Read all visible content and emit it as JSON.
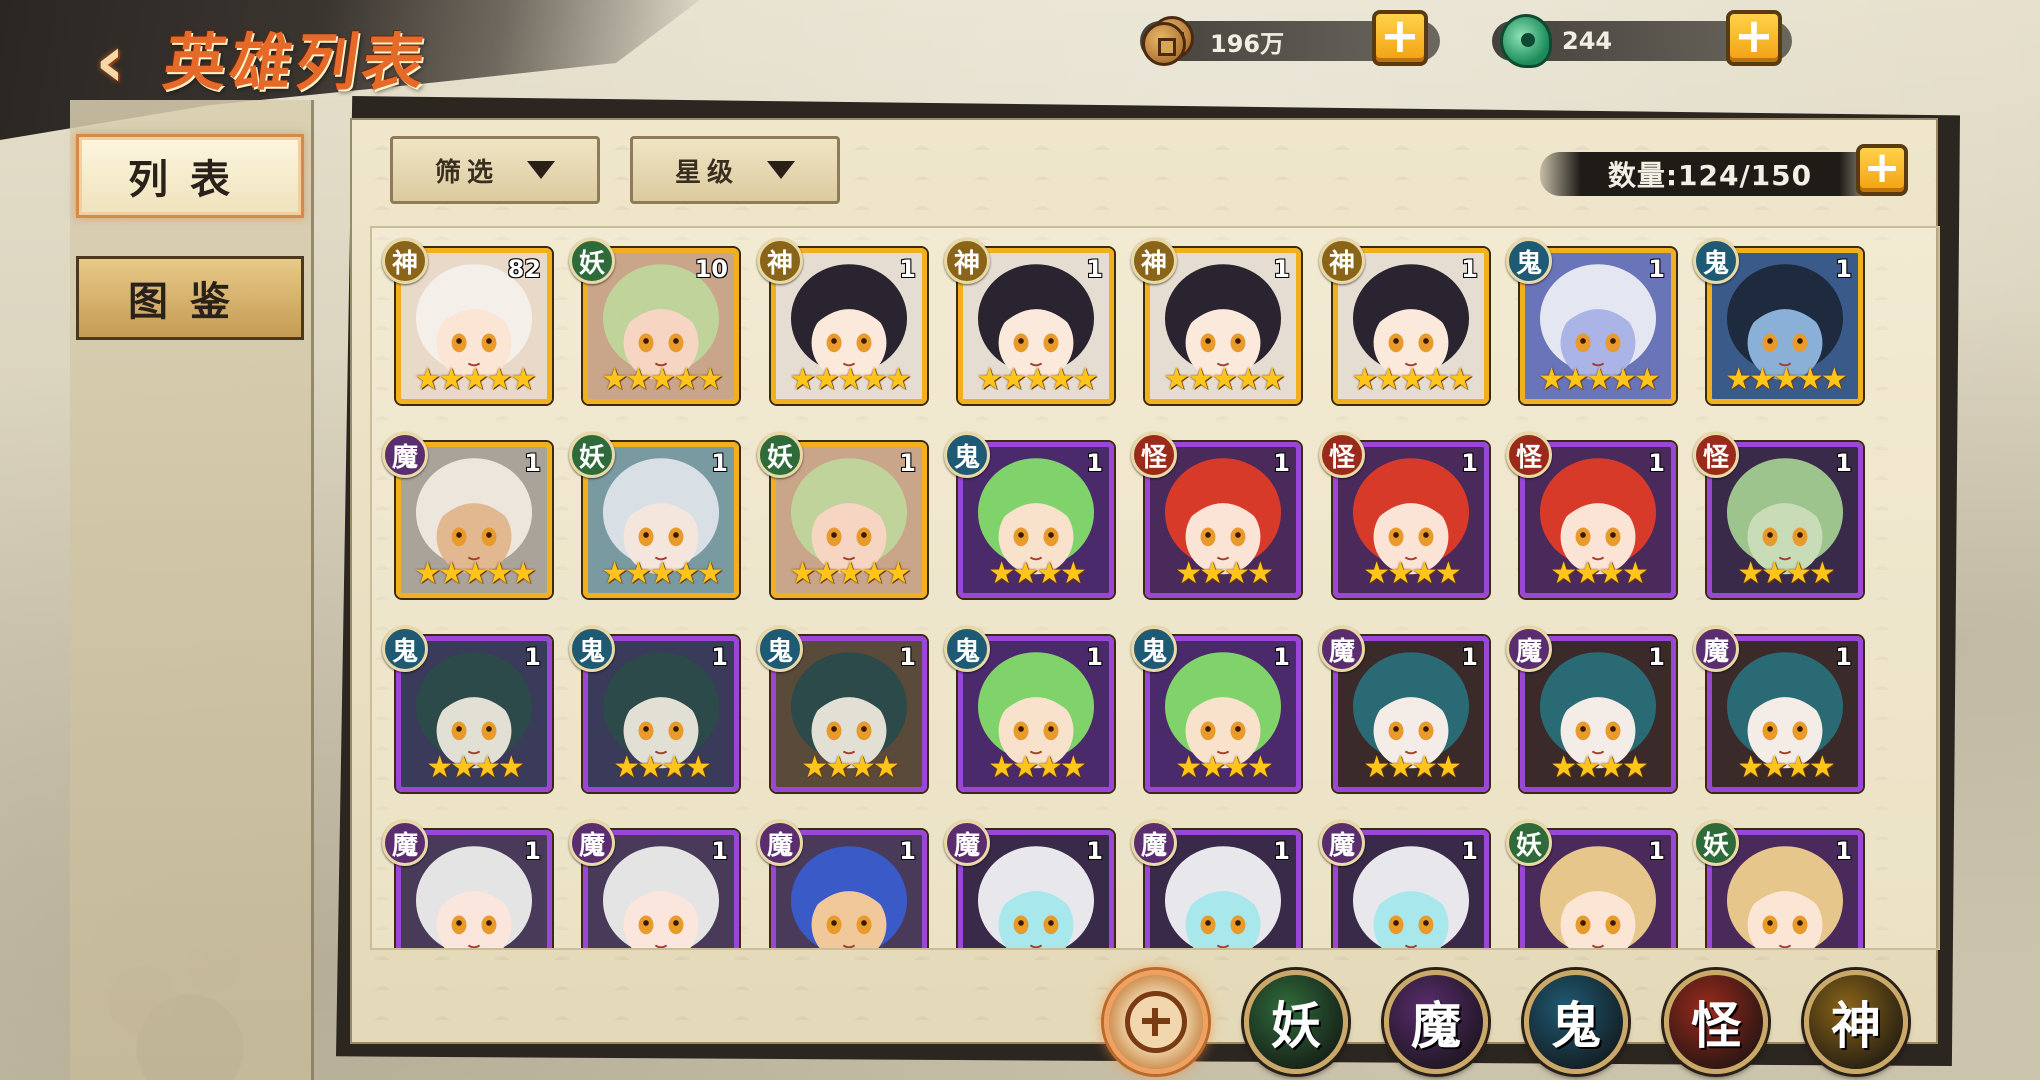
{
  "header": {
    "title": "英雄列表",
    "back_label": "‹"
  },
  "currency": {
    "coins": "196万",
    "jade": "244",
    "plus_label": "+"
  },
  "sidebar": {
    "tabs": [
      {
        "label": "列表",
        "active": true
      },
      {
        "label": "图鉴",
        "active": false
      }
    ]
  },
  "filters": {
    "filter_label": "筛选",
    "star_label": "星级"
  },
  "count": {
    "text": "数量:124/150",
    "plus_label": "+"
  },
  "factions": {
    "all": {
      "icon": "all-factions-emblem-icon"
    },
    "items": [
      {
        "label": "妖",
        "color": "#2f6b3a"
      },
      {
        "label": "魔",
        "color": "#5a2d6e"
      },
      {
        "label": "鬼",
        "color": "#1f5a74"
      },
      {
        "label": "怪",
        "color": "#9a2a1c"
      },
      {
        "label": "神",
        "color": "#8a6418"
      }
    ]
  },
  "colors": {
    "gold_frame": "#f2b01e",
    "purple_frame": "#9a46d6",
    "badge_神": "#8a6418",
    "badge_妖": "#2f6b3a",
    "badge_魔": "#5a2d6e",
    "badge_鬼": "#1f5a74",
    "badge_怪": "#9a2a1c"
  },
  "heroes": [
    {
      "type": "神",
      "level": "82",
      "stars": "★★★★★",
      "frame": "gold",
      "hair": "#f4efe8",
      "skin": "#fbe6d6",
      "bg": "#e9d9c8"
    },
    {
      "type": "妖",
      "level": "10",
      "stars": "★★★★★",
      "frame": "gold",
      "hair": "#bfd39a",
      "skin": "#f6d6c2",
      "bg": "#c9a58a"
    },
    {
      "type": "神",
      "level": "1",
      "stars": "★★★★★",
      "frame": "gold",
      "hair": "#2a2430",
      "skin": "#fbe9dc",
      "bg": "#e6ddd2"
    },
    {
      "type": "神",
      "level": "1",
      "stars": "★★★★★",
      "frame": "gold",
      "hair": "#2a2430",
      "skin": "#fbe9dc",
      "bg": "#e6ddd2"
    },
    {
      "type": "神",
      "level": "1",
      "stars": "★★★★★",
      "frame": "gold",
      "hair": "#2a2430",
      "skin": "#fbe9dc",
      "bg": "#e6ddd2"
    },
    {
      "type": "神",
      "level": "1",
      "stars": "★★★★★",
      "frame": "gold",
      "hair": "#2a2430",
      "skin": "#fbe9dc",
      "bg": "#e6ddd2"
    },
    {
      "type": "鬼",
      "level": "1",
      "stars": "★★★★★",
      "frame": "gold",
      "hair": "#e4e6f2",
      "skin": "#aab4e6",
      "bg": "#6a74b8"
    },
    {
      "type": "鬼",
      "level": "1",
      "stars": "★★★★★",
      "frame": "gold",
      "hair": "#1e2a3e",
      "skin": "#8ab0d8",
      "bg": "#3a5a8a"
    },
    {
      "type": "魔",
      "level": "1",
      "stars": "★★★★★",
      "frame": "gold",
      "hair": "#ece6dc",
      "skin": "#e2b890",
      "bg": "#a9a39a"
    },
    {
      "type": "妖",
      "level": "1",
      "stars": "★★★★★",
      "frame": "gold",
      "hair": "#d8e0e6",
      "skin": "#f4e6dc",
      "bg": "#7a9aa2"
    },
    {
      "type": "妖",
      "level": "1",
      "stars": "★★★★★",
      "frame": "gold",
      "hair": "#bfd39a",
      "skin": "#f6d6c2",
      "bg": "#c9a58a"
    },
    {
      "type": "鬼",
      "level": "1",
      "stars": "★★★★",
      "frame": "purple",
      "hair": "#7fd36a",
      "skin": "#f8e2cc",
      "bg": "#4a2a6a"
    },
    {
      "type": "怪",
      "level": "1",
      "stars": "★★★★",
      "frame": "purple",
      "hair": "#d83a2a",
      "skin": "#fbe4d6",
      "bg": "#4a2a5a"
    },
    {
      "type": "怪",
      "level": "1",
      "stars": "★★★★",
      "frame": "purple",
      "hair": "#d83a2a",
      "skin": "#fbe4d6",
      "bg": "#4a2a5a"
    },
    {
      "type": "怪",
      "level": "1",
      "stars": "★★★★",
      "frame": "purple",
      "hair": "#d83a2a",
      "skin": "#fbe4d6",
      "bg": "#4a2a5a"
    },
    {
      "type": "怪",
      "level": "1",
      "stars": "★★★★",
      "frame": "purple",
      "hair": "#9ec48e",
      "skin": "#c8dcb8",
      "bg": "#3a2a4a"
    },
    {
      "type": "鬼",
      "level": "1",
      "stars": "★★★★",
      "frame": "purple",
      "hair": "#2c4a4a",
      "skin": "#e2e0d4",
      "bg": "#3a3a5a"
    },
    {
      "type": "鬼",
      "level": "1",
      "stars": "★★★★",
      "frame": "purple",
      "hair": "#2c4a4a",
      "skin": "#e2e0d4",
      "bg": "#3a3a5a"
    },
    {
      "type": "鬼",
      "level": "1",
      "stars": "★★★★",
      "frame": "purple",
      "hair": "#2c4a4a",
      "skin": "#e2e0d4",
      "bg": "#5a4a3a"
    },
    {
      "type": "鬼",
      "level": "1",
      "stars": "★★★★",
      "frame": "purple",
      "hair": "#7fd36a",
      "skin": "#f8e2cc",
      "bg": "#4a2a6a"
    },
    {
      "type": "鬼",
      "level": "1",
      "stars": "★★★★",
      "frame": "purple",
      "hair": "#7fd36a",
      "skin": "#f8e2cc",
      "bg": "#4a2a6a"
    },
    {
      "type": "魔",
      "level": "1",
      "stars": "★★★★",
      "frame": "purple",
      "hair": "#2a6a74",
      "skin": "#f4ece6",
      "bg": "#3a2a2a"
    },
    {
      "type": "魔",
      "level": "1",
      "stars": "★★★★",
      "frame": "purple",
      "hair": "#2a6a74",
      "skin": "#f4ece6",
      "bg": "#3a2a2a"
    },
    {
      "type": "魔",
      "level": "1",
      "stars": "★★★★",
      "frame": "purple",
      "hair": "#2a6a74",
      "skin": "#f4ece6",
      "bg": "#3a2a2a"
    },
    {
      "type": "魔",
      "level": "1",
      "stars": "",
      "frame": "purple",
      "hair": "#e4e4e4",
      "skin": "#fae6dc",
      "bg": "#4a3a5a"
    },
    {
      "type": "魔",
      "level": "1",
      "stars": "",
      "frame": "purple",
      "hair": "#e4e4e4",
      "skin": "#fae6dc",
      "bg": "#4a3a5a"
    },
    {
      "type": "魔",
      "level": "1",
      "stars": "",
      "frame": "purple",
      "hair": "#3a5ac8",
      "skin": "#f0c89a",
      "bg": "#4a3a5a"
    },
    {
      "type": "魔",
      "level": "1",
      "stars": "",
      "frame": "purple",
      "hair": "#e8e8ec",
      "skin": "#a8e8ec",
      "bg": "#3a2a4a"
    },
    {
      "type": "魔",
      "level": "1",
      "stars": "",
      "frame": "purple",
      "hair": "#e8e8ec",
      "skin": "#a8e8ec",
      "bg": "#3a2a4a"
    },
    {
      "type": "魔",
      "level": "1",
      "stars": "",
      "frame": "purple",
      "hair": "#e8e8ec",
      "skin": "#a8e8ec",
      "bg": "#3a2a4a"
    },
    {
      "type": "妖",
      "level": "1",
      "stars": "",
      "frame": "purple",
      "hair": "#e6c68a",
      "skin": "#fbe6d6",
      "bg": "#4a2a5a"
    },
    {
      "type": "妖",
      "level": "1",
      "stars": "",
      "frame": "purple",
      "hair": "#e6c68a",
      "skin": "#fbe6d6",
      "bg": "#4a2a5a"
    }
  ]
}
